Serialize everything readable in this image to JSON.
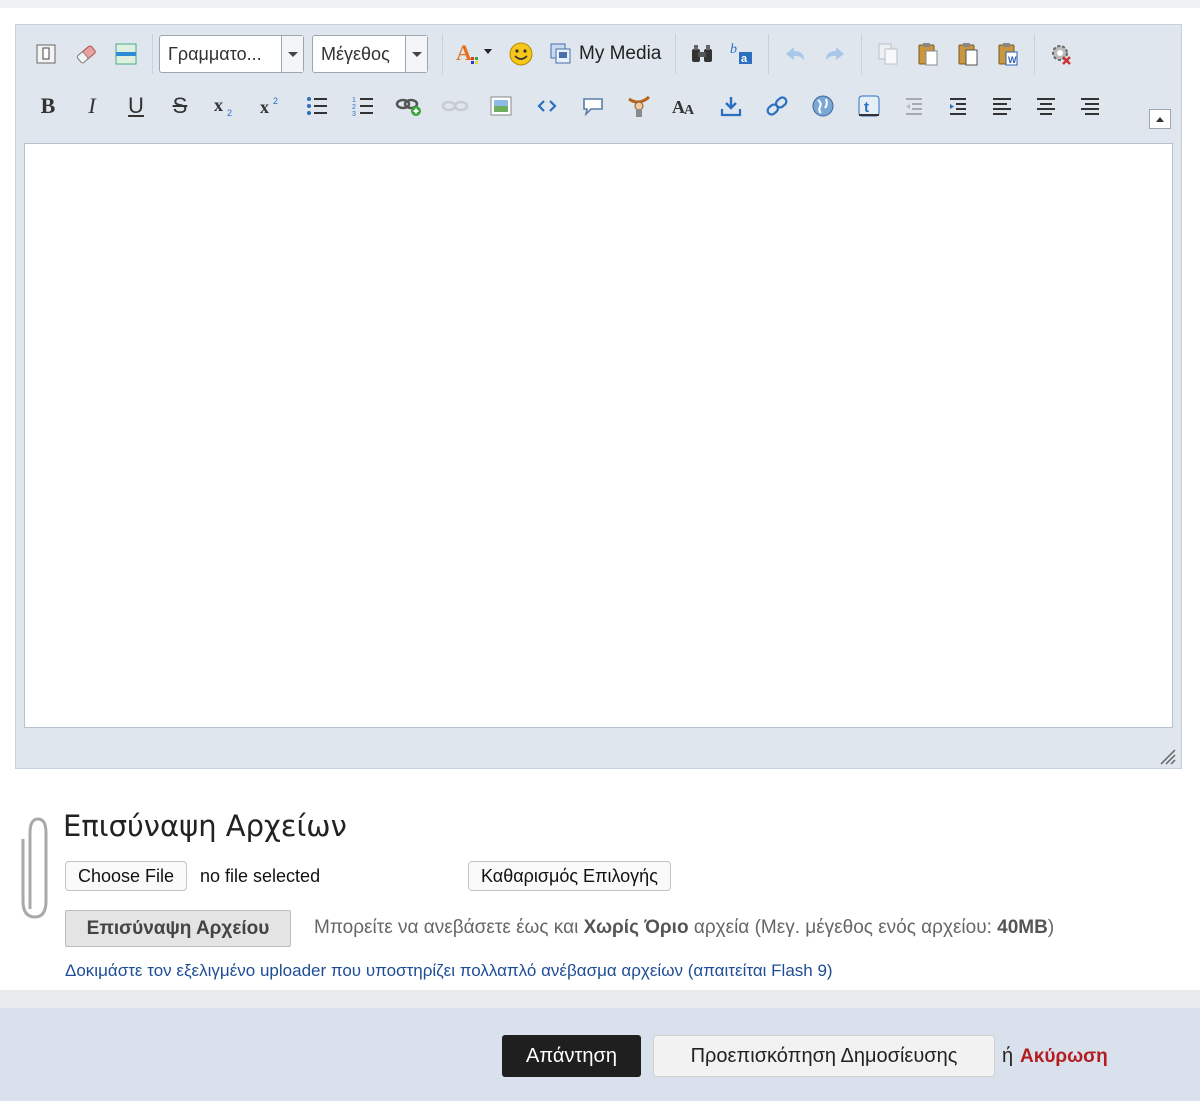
{
  "editor": {
    "font_select": "Γραμματο...",
    "size_select": "Μέγεθος",
    "my_media_label": "My Media",
    "text_content": ""
  },
  "attachments": {
    "title": "Επισύναψη Αρχείων",
    "choose_file_label": "Choose File",
    "no_file_text": "no file selected",
    "clear_selection_label": "Καθαρισμός Επιλογής",
    "attach_button_label": "Επισύναψη Αρχείου",
    "upload_info_prefix": "Μπορείτε να ανεβάσετε έως και",
    "upload_info_limit": "Χωρίς Όριο",
    "upload_info_middle": "αρχεία (Μεγ. μέγεθος ενός αρχείου:",
    "upload_info_size": "40MB",
    "upload_info_suffix": ")",
    "flash_uploader_link": "Δοκιμάστε τον εξελιγμένο uploader που υποστηρίζει πολλαπλό ανέβασμα αρχείων (απαιτείται Flash 9)"
  },
  "footer": {
    "reply_label": "Απάντηση",
    "preview_label": "Προεπισκόπηση Δημοσίευσης",
    "or_text": "ή",
    "cancel_label": "Ακύρωση"
  },
  "colors": {
    "cancel": "#b31d22",
    "link": "#1e4d96",
    "editor_bg": "#dfe6ee",
    "footer_bg": "#d9e2ec"
  },
  "icons": {
    "row1": [
      "switch-mode-icon",
      "remove-format-icon",
      "horizontal-rule-icon",
      "font-color-icon",
      "smiley-icon",
      "my-media-icon",
      "find-icon",
      "translate-icon",
      "undo-icon",
      "redo-icon",
      "copy-icon",
      "paste-icon",
      "paste-text-icon",
      "paste-word-icon",
      "settings-icon"
    ],
    "row2": [
      "bold-icon",
      "italic-icon",
      "underline-icon",
      "strikethrough-icon",
      "subscript-icon",
      "superscript-icon",
      "bullet-list-icon",
      "numbered-list-icon",
      "link-icon",
      "unlink-icon",
      "image-icon",
      "code-icon",
      "quote-icon",
      "spoiler-icon",
      "font-size-icon",
      "download-icon",
      "url-icon",
      "globe-icon",
      "twitter-icon",
      "outdent-icon",
      "indent-icon",
      "align-left-icon",
      "align-center-icon",
      "align-right-icon"
    ]
  }
}
